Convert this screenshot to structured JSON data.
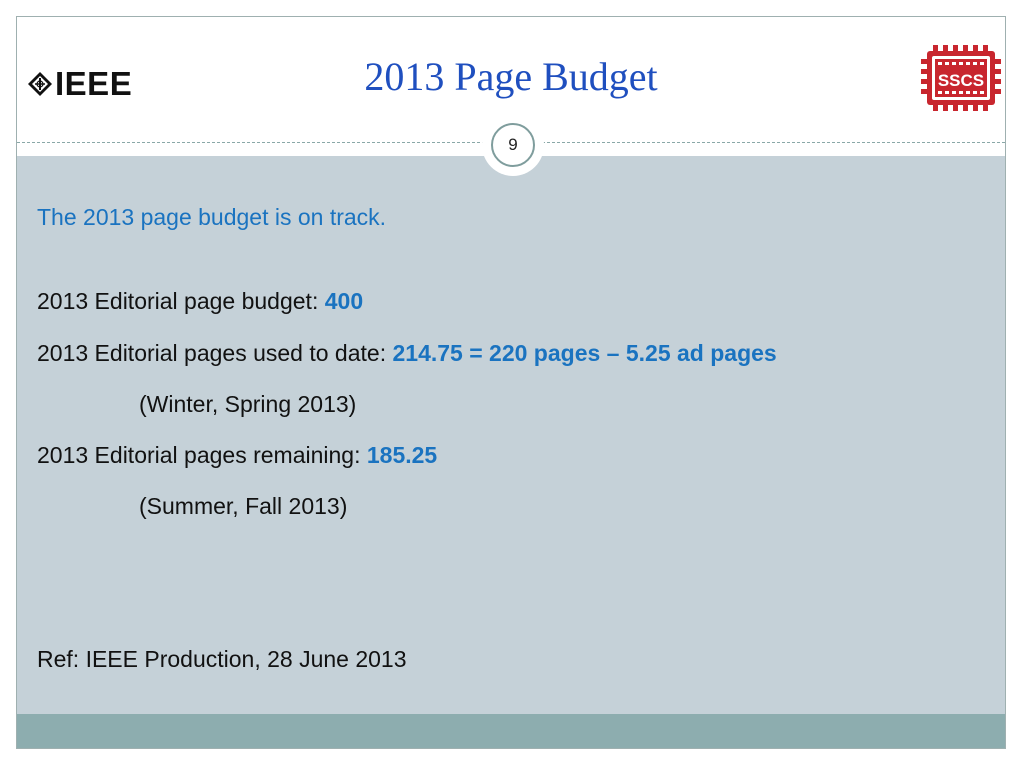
{
  "header": {
    "title": "2013 Page Budget",
    "left_logo_text": "IEEE",
    "right_logo_text": "SSCS",
    "page_number": "9"
  },
  "content": {
    "intro": "The 2013 page budget is on track.",
    "budget_label": "2013 Editorial page budget: ",
    "budget_value": "400",
    "used_label": "2013 Editorial pages used to date: ",
    "used_value": "214.75 = 220 pages – 5.25 ad pages",
    "used_note": "(Winter, Spring 2013)",
    "remaining_label": "2013 Editorial pages remaining: ",
    "remaining_value": "185.25",
    "remaining_note": "(Summer, Fall 2013)",
    "reference": "Ref: IEEE Production, 28 June 2013"
  },
  "colors": {
    "title": "#1f4fbf",
    "accent_text": "#1a73c0",
    "content_background": "#c5d1d8",
    "footer_bar": "#8dadaf",
    "sscs_red": "#c8262e"
  }
}
